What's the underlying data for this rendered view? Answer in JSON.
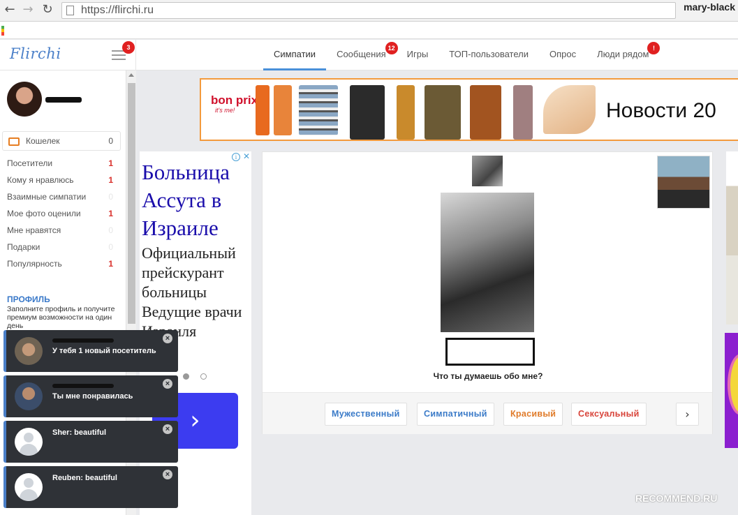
{
  "browser": {
    "url": "https://flirchi.ru",
    "profile_name": "mary-black",
    "back_icon": "back-arrow-icon",
    "forward_icon": "forward-arrow-icon",
    "reload_icon": "reload-icon"
  },
  "header": {
    "logo": "Flirchi",
    "menu_badge": "3",
    "tabs": [
      {
        "label": "Симпатии",
        "badge": ""
      },
      {
        "label": "Сообщения",
        "badge": "12"
      },
      {
        "label": "Игры",
        "badge": ""
      },
      {
        "label": "ТОП-пользователи",
        "badge": ""
      },
      {
        "label": "Опрос",
        "badge": ""
      },
      {
        "label": "Люди рядом",
        "badge": "!"
      }
    ]
  },
  "sidebar": {
    "wallet": {
      "label": "Кошелек",
      "count": "0"
    },
    "stats": [
      {
        "label": "Посетители",
        "count": "1"
      },
      {
        "label": "Кому я нравлюсь",
        "count": "1"
      },
      {
        "label": "Взаимные симпатии",
        "count": "0"
      },
      {
        "label": "Мое фото оценили",
        "count": "1"
      },
      {
        "label": "Мне нравятся",
        "count": "0"
      },
      {
        "label": "Подарки",
        "count": "0"
      },
      {
        "label": "Популярность",
        "count": "1"
      }
    ],
    "profile_title": "ПРОФИЛЬ",
    "profile_desc": "Заполните профиль и получите премиум возможности на один день"
  },
  "notifications": [
    {
      "text": "У тебя 1 новый посетитель",
      "avatar": "photo1"
    },
    {
      "text": "Ты мне понравилась",
      "avatar": "photo2"
    },
    {
      "text": "Sher: beautiful",
      "avatar": "default"
    },
    {
      "text": "Reuben: beautiful",
      "avatar": "default"
    }
  ],
  "ad_left": {
    "title": "Больница Ассута в Израиле",
    "body": "Официальный прейскурант больницы Ведущие врачи Израиля",
    "arrow": "›"
  },
  "banner": {
    "brand": "bon prix",
    "brand_tagline": "it's me!",
    "news_text": "Новости 20"
  },
  "card": {
    "question": "Что ты думаешь обо мне?",
    "buttons": [
      "Мужественный",
      "Симпатичный",
      "Красивый",
      "Сексуальный"
    ],
    "next": "›"
  },
  "watermark": "RECOMMEND.RU",
  "colors": {
    "accent": "#4a90d9",
    "badge": "#e02020",
    "notification_bg": "#2f3237",
    "banner_border": "#f39a3c"
  }
}
